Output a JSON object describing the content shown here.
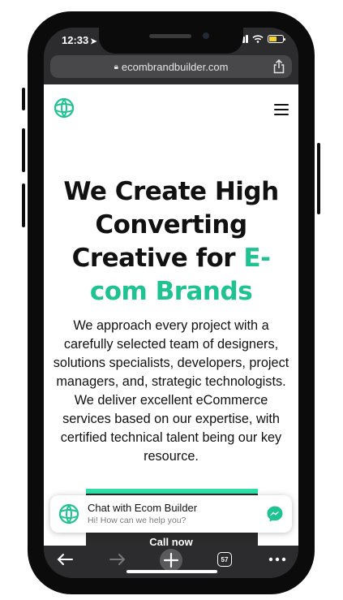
{
  "status_bar": {
    "time": "12:33",
    "location_icon": "location-arrow-icon",
    "battery_color": "#f4d433"
  },
  "browser": {
    "url": "ecombrandbuilder.com",
    "lock_icon": "lock-icon",
    "share_icon": "share-icon",
    "toolbar": {
      "tab_count": "57"
    }
  },
  "site": {
    "brand_color": "#1fc291",
    "hero": {
      "title_line1": "We Create High",
      "title_line2": "Converting",
      "title_line3_plain": "Creative for ",
      "title_line3_accent": "E-",
      "title_line4_accent": "com Brands",
      "paragraph": "We approach every project with a carefully selected team of designers, solutions specialists, developers, project managers, and, strategic technologists. We deliver excellent eCommerce services based on our expertise, with certified technical talent being our key resource."
    },
    "cta_label": "Call now"
  },
  "chat_widget": {
    "title": "Chat with Ecom Builder",
    "subtitle": "Hi! How can we help you?"
  }
}
